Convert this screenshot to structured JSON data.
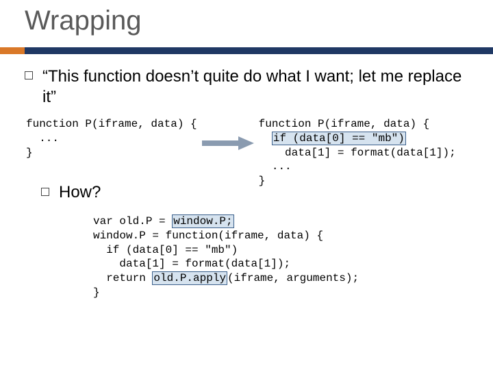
{
  "title": "Wrapping",
  "bullet1": "“This function doesn’t quite do what I want; let me replace it”",
  "how": "How?",
  "code": {
    "left": {
      "l1": "function P(iframe, data) {",
      "l2": "  ...",
      "l3": "}"
    },
    "right": {
      "l1": "function P(iframe, data) {",
      "l2a": "  ",
      "l2b": "if (data[0] == \"mb\")",
      "l3": "    data[1] = format(data[1]);",
      "l4": "  ...",
      "l5": "}"
    },
    "bottom": {
      "l1a": "var old.P = ",
      "l1b": "window.P;",
      "l2": "window.P = function(iframe, data) {",
      "l3": "  if (data[0] == \"mb\")",
      "l4": "    data[1] = format(data[1]);",
      "l5a": "  return ",
      "l5b": "old.P.apply",
      "l5c": "(iframe, arguments);",
      "l6": "}"
    }
  }
}
